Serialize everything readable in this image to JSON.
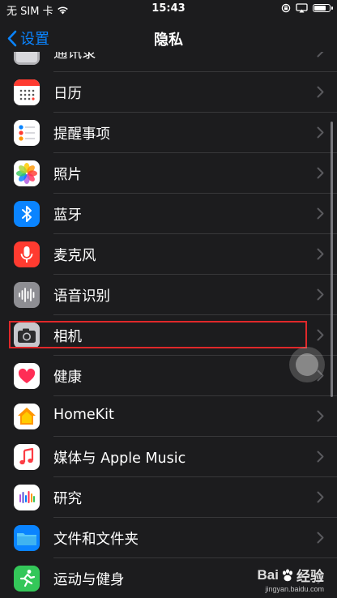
{
  "status_bar": {
    "carrier": "无 SIM 卡",
    "time": "15:43",
    "battery_level": 0.85
  },
  "nav": {
    "back_label": "设置",
    "title": "隐私"
  },
  "rows": [
    {
      "label": "通讯录",
      "icon": "contacts-icon"
    },
    {
      "label": "日历",
      "icon": "calendar-icon"
    },
    {
      "label": "提醒事项",
      "icon": "reminders-icon"
    },
    {
      "label": "照片",
      "icon": "photos-icon"
    },
    {
      "label": "蓝牙",
      "icon": "bluetooth-icon"
    },
    {
      "label": "麦克风",
      "icon": "microphone-icon"
    },
    {
      "label": "语音识别",
      "icon": "speech-recognition-icon"
    },
    {
      "label": "相机",
      "icon": "camera-icon",
      "highlighted": true
    },
    {
      "label": "健康",
      "icon": "health-icon"
    },
    {
      "label": "HomeKit",
      "icon": "homekit-icon"
    },
    {
      "label": "媒体与 Apple Music",
      "icon": "music-icon"
    },
    {
      "label": "研究",
      "icon": "research-icon"
    },
    {
      "label": "文件和文件夹",
      "icon": "folder-icon"
    },
    {
      "label": "运动与健身",
      "icon": "fitness-icon"
    }
  ],
  "colors": {
    "accent": "#0a84ff",
    "highlight": "#e0282a",
    "background": "#1c1c1e",
    "separator": "#38383a"
  },
  "watermark": {
    "brand": "Bai",
    "brand_suffix": "经验",
    "url": "jingyan.baidu.com"
  }
}
